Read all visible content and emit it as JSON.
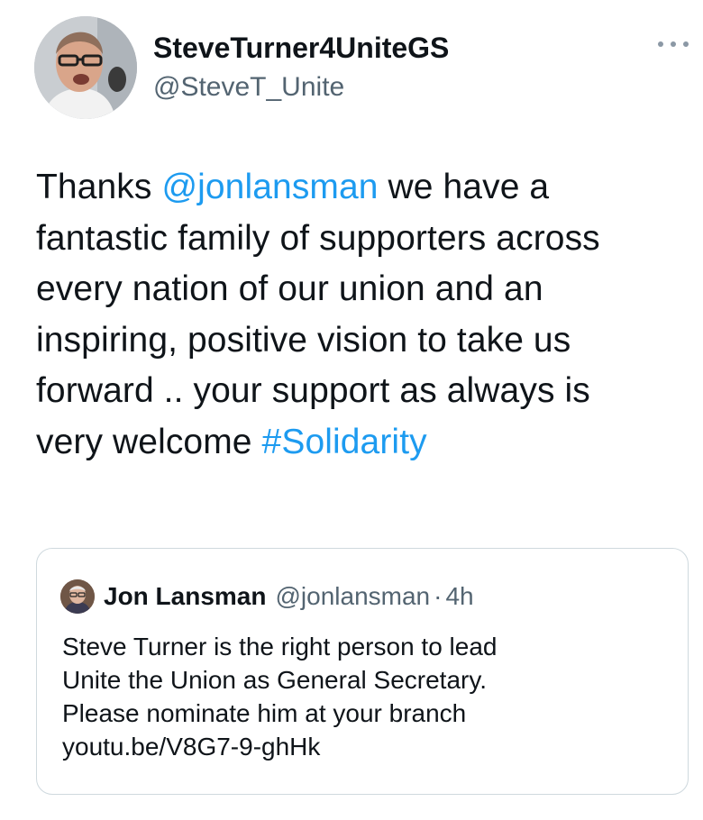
{
  "author": {
    "display_name": "SteveTurner4UniteGS",
    "handle": "@SteveT_Unite",
    "avatar_icon": "user-avatar-icon"
  },
  "more_icon": "more-horizontal-icon",
  "tweet": {
    "lines": [
      [
        {
          "text": "Thanks ",
          "type": "text"
        },
        {
          "text": "@jonlansman",
          "type": "mention"
        },
        {
          "text": " we have a",
          "type": "text"
        }
      ],
      [
        {
          "text": "fantastic family of supporters across",
          "type": "text"
        }
      ],
      [
        {
          "text": "every nation of our union and an",
          "type": "text"
        }
      ],
      [
        {
          "text": "inspiring, positive vision to take us",
          "type": "text"
        }
      ],
      [
        {
          "text": "forward .. your support as always is",
          "type": "text"
        }
      ],
      [
        {
          "text": "very welcome ",
          "type": "text"
        },
        {
          "text": "#Solidarity",
          "type": "hashtag"
        }
      ]
    ]
  },
  "quoted": {
    "display_name": "Jon Lansman",
    "handle": "@jonlansman",
    "separator": "·",
    "time": "4h",
    "avatar_icon": "user-avatar-icon",
    "lines": [
      "Steve Turner is the right person to lead",
      "Unite the Union as General Secretary.",
      "Please nominate him at your branch",
      "youtu.be/V8G7-9-ghHk"
    ]
  },
  "colors": {
    "link": "#1d9bf0",
    "text": "#0f1419",
    "secondary": "#536471",
    "border": "#cfd9de"
  }
}
